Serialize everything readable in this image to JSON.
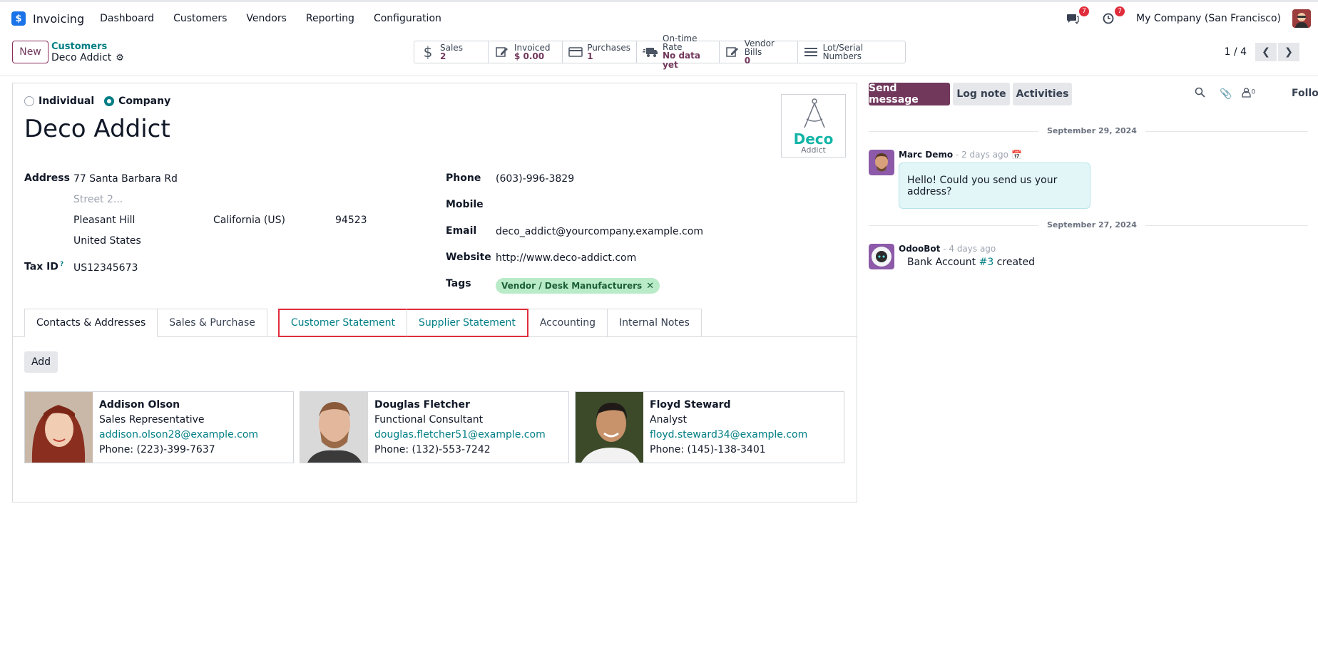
{
  "app": {
    "name": "Invoicing"
  },
  "menu": [
    "Dashboard",
    "Customers",
    "Vendors",
    "Reporting",
    "Configuration"
  ],
  "systray": {
    "messages_count": "7",
    "activities_count": "7",
    "company": "My Company (San Francisco)"
  },
  "control": {
    "new_label": "New",
    "breadcrumb_parent": "Customers",
    "breadcrumb_current": "Deco Addict",
    "pager": "1 / 4"
  },
  "smart_buttons": [
    {
      "icon": "dollar-icon",
      "label": "Sales",
      "value": "2"
    },
    {
      "icon": "invoice-edit-icon",
      "label": "Invoiced",
      "value": "$ 0.00"
    },
    {
      "icon": "credit-card-icon",
      "label": "Purchases",
      "value": "1"
    },
    {
      "icon": "truck-icon",
      "label": "On-time Rate",
      "value": "No data yet"
    },
    {
      "icon": "bill-edit-icon",
      "label": "Vendor Bills",
      "value": "0"
    },
    {
      "icon": "list-icon",
      "label": "Lot/Serial Numbers",
      "value": ""
    }
  ],
  "form": {
    "type_individual": "Individual",
    "type_company": "Company",
    "selected_type": "Company",
    "name": "Deco Addict",
    "logo": {
      "line1": "Deco",
      "line2": "Addict"
    },
    "address_label": "Address",
    "street": "77 Santa Barbara Rd",
    "street2_placeholder": "Street 2...",
    "city": "Pleasant Hill",
    "state": "California (US)",
    "zip": "94523",
    "country": "United States",
    "tax_label": "Tax ID",
    "tax_help": "?",
    "tax_id": "US12345673",
    "phone_label": "Phone",
    "phone": "(603)-996-3829",
    "mobile_label": "Mobile",
    "email_label": "Email",
    "email": "deco_addict@yourcompany.example.com",
    "website_label": "Website",
    "website": "http://www.deco-addict.com",
    "tags_label": "Tags",
    "tag": "Vendor / Desk Manufacturers",
    "tag_remove": "✕"
  },
  "tabs": [
    "Contacts & Addresses",
    "Sales & Purchase",
    "Customer Statement",
    "Supplier Statement",
    "Accounting",
    "Internal Notes"
  ],
  "add_label": "Add",
  "contacts": [
    {
      "name": "Addison Olson",
      "role": "Sales Representative",
      "email": "addison.olson28@example.com",
      "phone": "Phone: (223)-399-7637"
    },
    {
      "name": "Douglas Fletcher",
      "role": "Functional Consultant",
      "email": "douglas.fletcher51@example.com",
      "phone": "Phone: (132)-553-7242"
    },
    {
      "name": "Floyd Steward",
      "role": "Analyst",
      "email": "floyd.steward34@example.com",
      "phone": "Phone: (145)-138-3401"
    }
  ],
  "chatter": {
    "send_message": "Send message",
    "log_note": "Log note",
    "activities": "Activities",
    "followers_count": "0",
    "follow": "Follow",
    "date1": "September 29, 2024",
    "msg1_author": "Marc Demo",
    "msg1_ago": " - 2 days ago",
    "msg1_body": "Hello! Could you send us your address?",
    "date2": "September 27, 2024",
    "msg2_author": "OdooBot",
    "msg2_ago": " - 4 days ago",
    "msg2_pre": "Bank Account ",
    "msg2_link": "#3",
    "msg2_post": " created"
  },
  "colors": {
    "brand": "#71385c",
    "accent": "#017e84",
    "highlight": "#e02d3c"
  }
}
